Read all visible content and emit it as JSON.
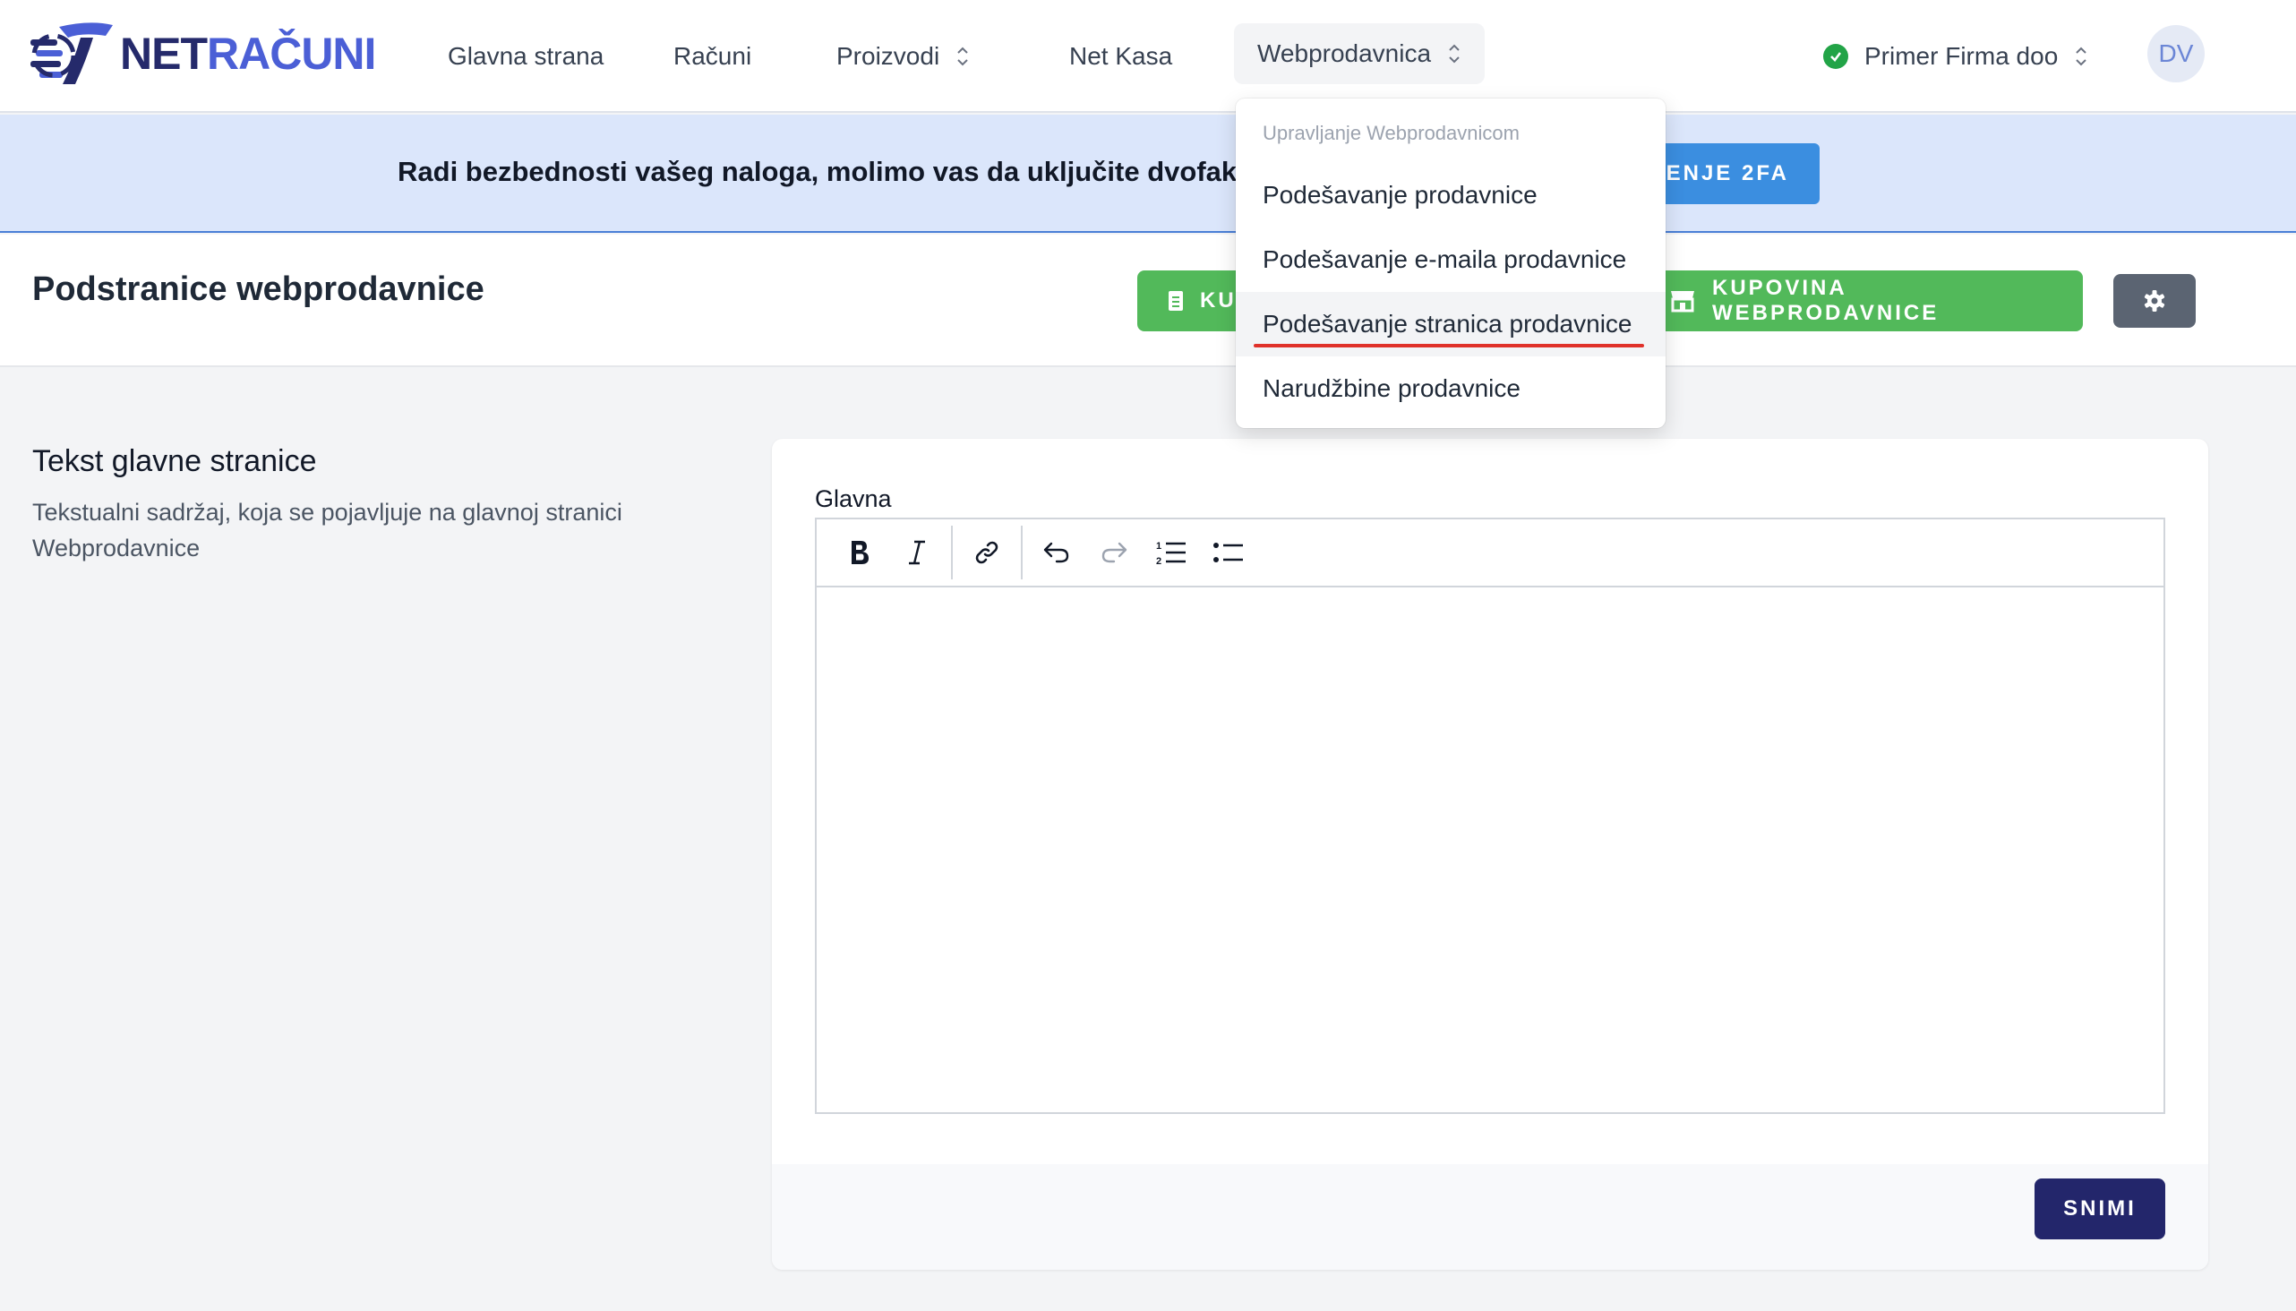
{
  "brand": {
    "name_part1": "NET",
    "name_part2": "RAČUNI",
    "color_dark": "#252a6b",
    "color_accent": "#4b5fd6"
  },
  "nav": {
    "items": [
      {
        "label": "Glavna strana"
      },
      {
        "label": "Računi"
      },
      {
        "label": "Proizvodi"
      },
      {
        "label": "Net Kasa"
      },
      {
        "label": "Webprodavnica"
      }
    ],
    "company": "Primer Firma doo",
    "avatar_initials": "DV"
  },
  "banner": {
    "text": "Radi bezbednosti vašeg naloga, molimo vas da uključite dvofaktorsku",
    "button_label": "ČENJE 2FA"
  },
  "page": {
    "title": "Podstranice webprodavnice",
    "btn_left_label": "KU",
    "btn_buy_label": "KUPOVINA WEBPRODAVNICE",
    "gear_icon": "gear-icon"
  },
  "section": {
    "title": "Tekst glavne stranice",
    "description": "Tekstualni sadržaj, koja se pojavljuje na glavnoj stranici Webprodavnice"
  },
  "editor": {
    "label": "Glavna",
    "tools": [
      "bold-icon",
      "italic-icon",
      "link-icon",
      "undo-icon",
      "redo-icon",
      "ordered-list-icon",
      "bullet-list-icon"
    ],
    "content": ""
  },
  "footer": {
    "save_label": "SNIMI"
  },
  "dropdown": {
    "header": "Upravljanje Webprodavnicom",
    "items": [
      {
        "label": "Podešavanje prodavnice"
      },
      {
        "label": "Podešavanje e-maila prodavnice"
      },
      {
        "label": "Podešavanje stranica prodavnice"
      },
      {
        "label": "Narudžbine prodavnice"
      }
    ]
  },
  "colors": {
    "green": "#52b95a",
    "save": "#23266b",
    "banner_bg": "#dbe6fb",
    "banner_btn": "#3b8ee0",
    "highlight": "#e0312a"
  }
}
